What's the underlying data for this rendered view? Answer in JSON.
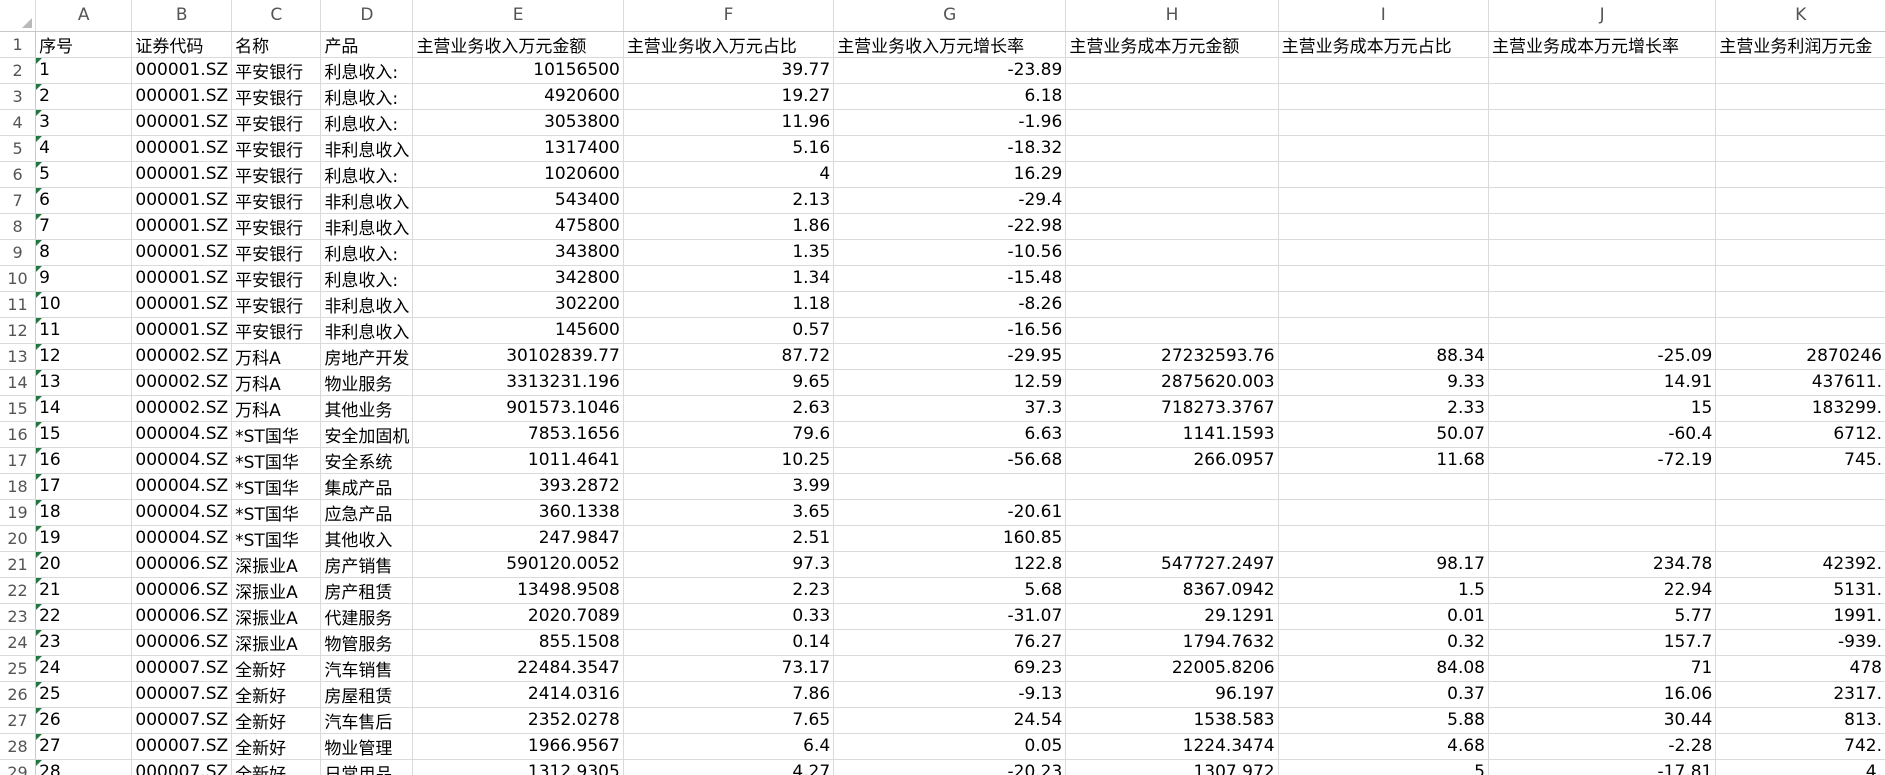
{
  "columns": [
    "A",
    "B",
    "C",
    "D",
    "E",
    "F",
    "G",
    "H",
    "I",
    "J",
    "K"
  ],
  "header_row": [
    "序号",
    "证券代码",
    "名称",
    "产品",
    "主营业务收入万元金额",
    "主营业务收入万元占比",
    "主营业务收入万元增长率",
    "主营业务成本万元金额",
    "主营业务成本万元占比",
    "主营业务成本万元增长率",
    "主营业务利润万元金"
  ],
  "rows": [
    [
      "1",
      "000001.SZ",
      "平安银行",
      "利息收入:",
      "10156500",
      "39.77",
      "-23.89",
      "",
      "",
      "",
      ""
    ],
    [
      "2",
      "000001.SZ",
      "平安银行",
      "利息收入:",
      "4920600",
      "19.27",
      "6.18",
      "",
      "",
      "",
      ""
    ],
    [
      "3",
      "000001.SZ",
      "平安银行",
      "利息收入:",
      "3053800",
      "11.96",
      "-1.96",
      "",
      "",
      "",
      ""
    ],
    [
      "4",
      "000001.SZ",
      "平安银行",
      "非利息收入",
      "1317400",
      "5.16",
      "-18.32",
      "",
      "",
      "",
      ""
    ],
    [
      "5",
      "000001.SZ",
      "平安银行",
      "利息收入:",
      "1020600",
      "4",
      "16.29",
      "",
      "",
      "",
      ""
    ],
    [
      "6",
      "000001.SZ",
      "平安银行",
      "非利息收入",
      "543400",
      "2.13",
      "-29.4",
      "",
      "",
      "",
      ""
    ],
    [
      "7",
      "000001.SZ",
      "平安银行",
      "非利息收入",
      "475800",
      "1.86",
      "-22.98",
      "",
      "",
      "",
      ""
    ],
    [
      "8",
      "000001.SZ",
      "平安银行",
      "利息收入:",
      "343800",
      "1.35",
      "-10.56",
      "",
      "",
      "",
      ""
    ],
    [
      "9",
      "000001.SZ",
      "平安银行",
      "利息收入:",
      "342800",
      "1.34",
      "-15.48",
      "",
      "",
      "",
      ""
    ],
    [
      "10",
      "000001.SZ",
      "平安银行",
      "非利息收入",
      "302200",
      "1.18",
      "-8.26",
      "",
      "",
      "",
      ""
    ],
    [
      "11",
      "000001.SZ",
      "平安银行",
      "非利息收入",
      "145600",
      "0.57",
      "-16.56",
      "",
      "",
      "",
      ""
    ],
    [
      "12",
      "000002.SZ",
      "万科A",
      "房地产开发",
      "30102839.77",
      "87.72",
      "-29.95",
      "27232593.76",
      "88.34",
      "-25.09",
      "2870246"
    ],
    [
      "13",
      "000002.SZ",
      "万科A",
      "物业服务",
      "3313231.196",
      "9.65",
      "12.59",
      "2875620.003",
      "9.33",
      "14.91",
      "437611."
    ],
    [
      "14",
      "000002.SZ",
      "万科A",
      "其他业务",
      "901573.1046",
      "2.63",
      "37.3",
      "718273.3767",
      "2.33",
      "15",
      "183299."
    ],
    [
      "15",
      "000004.SZ",
      "*ST国华",
      "安全加固机",
      "7853.1656",
      "79.6",
      "6.63",
      "1141.1593",
      "50.07",
      "-60.4",
      "6712."
    ],
    [
      "16",
      "000004.SZ",
      "*ST国华",
      "安全系统",
      "1011.4641",
      "10.25",
      "-56.68",
      "266.0957",
      "11.68",
      "-72.19",
      "745."
    ],
    [
      "17",
      "000004.SZ",
      "*ST国华",
      "集成产品",
      "393.2872",
      "3.99",
      "",
      "",
      "",
      "",
      ""
    ],
    [
      "18",
      "000004.SZ",
      "*ST国华",
      "应急产品",
      "360.1338",
      "3.65",
      "-20.61",
      "",
      "",
      "",
      ""
    ],
    [
      "19",
      "000004.SZ",
      "*ST国华",
      "其他收入",
      "247.9847",
      "2.51",
      "160.85",
      "",
      "",
      "",
      ""
    ],
    [
      "20",
      "000006.SZ",
      "深振业A",
      "房产销售",
      "590120.0052",
      "97.3",
      "122.8",
      "547727.2497",
      "98.17",
      "234.78",
      "42392."
    ],
    [
      "21",
      "000006.SZ",
      "深振业A",
      "房产租赁",
      "13498.9508",
      "2.23",
      "5.68",
      "8367.0942",
      "1.5",
      "22.94",
      "5131."
    ],
    [
      "22",
      "000006.SZ",
      "深振业A",
      "代建服务",
      "2020.7089",
      "0.33",
      "-31.07",
      "29.1291",
      "0.01",
      "5.77",
      "1991."
    ],
    [
      "23",
      "000006.SZ",
      "深振业A",
      "物管服务",
      "855.1508",
      "0.14",
      "76.27",
      "1794.7632",
      "0.32",
      "157.7",
      "-939."
    ],
    [
      "24",
      "000007.SZ",
      "全新好",
      "汽车销售",
      "22484.3547",
      "73.17",
      "69.23",
      "22005.8206",
      "84.08",
      "71",
      "478"
    ],
    [
      "25",
      "000007.SZ",
      "全新好",
      "房屋租赁",
      "2414.0316",
      "7.86",
      "-9.13",
      "96.197",
      "0.37",
      "16.06",
      "2317."
    ],
    [
      "26",
      "000007.SZ",
      "全新好",
      "汽车售后",
      "2352.0278",
      "7.65",
      "24.54",
      "1538.583",
      "5.88",
      "30.44",
      "813."
    ],
    [
      "27",
      "000007.SZ",
      "全新好",
      "物业管理",
      "1966.9567",
      "6.4",
      "0.05",
      "1224.3474",
      "4.68",
      "-2.28",
      "742."
    ],
    [
      "28",
      "000007.SZ",
      "全新好",
      "日常用品",
      "1312.9305",
      "4.27",
      "-20.23",
      "1307.972",
      "5",
      "-17.81",
      "4."
    ]
  ]
}
